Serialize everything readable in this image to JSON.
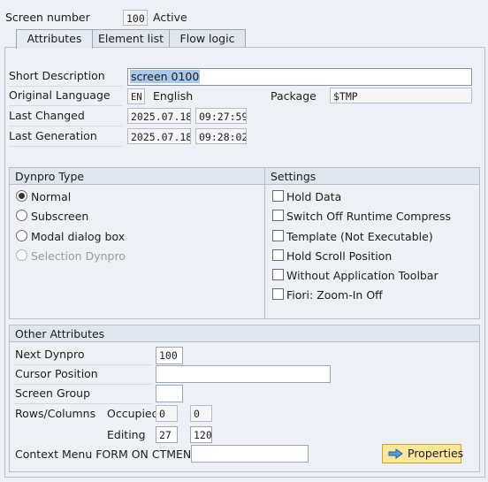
{
  "header": {
    "screen_number_label": "Screen number",
    "screen_number_value": "100",
    "status": "Active"
  },
  "tabs": [
    {
      "label": "Attributes",
      "active": true
    },
    {
      "label": "Element list",
      "active": false
    },
    {
      "label": "Flow logic",
      "active": false
    }
  ],
  "attributes": {
    "short_description_label": "Short Description",
    "short_description_value": "screen 0100",
    "original_language_label": "Original Language",
    "language_code": "EN",
    "language_name": "English",
    "package_label": "Package",
    "package_value": "$TMP",
    "last_changed_label": "Last Changed",
    "last_changed_date": "2025.07.18",
    "last_changed_time": "09:27:59",
    "last_generation_label": "Last Generation",
    "last_generation_date": "2025.07.18",
    "last_generation_time": "09:28:02"
  },
  "dynpro_type": {
    "title": "Dynpro Type",
    "options": [
      {
        "label": "Normal",
        "selected": true,
        "enabled": true
      },
      {
        "label": "Subscreen",
        "selected": false,
        "enabled": true
      },
      {
        "label": "Modal dialog box",
        "selected": false,
        "enabled": true
      },
      {
        "label": "Selection Dynpro",
        "selected": false,
        "enabled": false
      }
    ]
  },
  "settings": {
    "title": "Settings",
    "options": [
      {
        "label": "Hold Data",
        "checked": false
      },
      {
        "label": "Switch Off Runtime Compress",
        "checked": false
      },
      {
        "label": "Template (Not Executable)",
        "checked": false
      },
      {
        "label": "Hold Scroll Position",
        "checked": false
      },
      {
        "label": "Without Application Toolbar",
        "checked": false
      },
      {
        "label": "Fiori: Zoom-In Off",
        "checked": false
      }
    ]
  },
  "other_attributes": {
    "title": "Other Attributes",
    "next_dynpro_label": "Next Dynpro",
    "next_dynpro_value": "100",
    "cursor_position_label": "Cursor Position",
    "cursor_position_value": "",
    "screen_group_label": "Screen Group",
    "screen_group_value": "",
    "rows_columns_label": "Rows/Columns",
    "occupied_label": "Occupied",
    "occupied_rows": "0",
    "occupied_cols": "0",
    "editing_label": "Editing",
    "editing_rows": "27",
    "editing_cols": "120",
    "context_menu_label": "Context Menu FORM ON CTMENU",
    "context_menu_value": "",
    "properties_button": "Properties"
  },
  "colors": {
    "background": "#edf1f6",
    "button_yellow": "#fbe79c",
    "selection_highlight": "#a9c8ee"
  }
}
